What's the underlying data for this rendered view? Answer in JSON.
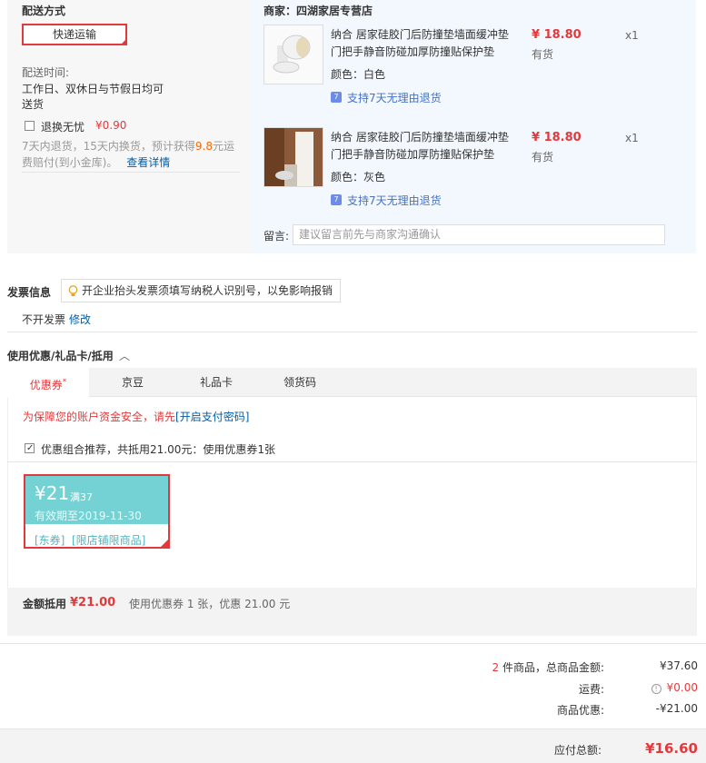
{
  "shipping": {
    "title": "配送方式",
    "method_button": "快递运输",
    "time_label": "配送时间:",
    "time_value_line1": "工作日、双休日与节假日均可",
    "time_value_line2": "送货",
    "insurance_label": "退换无忧",
    "insurance_price": "¥0.90",
    "insurance_desc_line1_a": "7天内退货，15天内换货，预计获得",
    "insurance_desc_highlight": "9.8",
    "insurance_desc_line1_b": "元运",
    "insurance_desc_line2": "费赔付(到小金库)。",
    "details_link": "查看详情"
  },
  "shop": {
    "name": "商家：四湖家居专营店",
    "products": [
      {
        "name": "纳合 居家硅胶门后防撞垫墙面缓冲垫门把手静音防碰加厚防撞贴保护垫",
        "color_label": "颜色：",
        "color": "白色",
        "price": "¥ 18.80",
        "stock": "有货",
        "qty": "x1",
        "return_policy": "支持7天无理由退货",
        "badge": "7"
      },
      {
        "name": "纳合 居家硅胶门后防撞垫墙面缓冲垫门把手静音防碰加厚防撞贴保护垫",
        "color_label": "颜色：",
        "color": "灰色",
        "price": "¥ 18.80",
        "stock": "有货",
        "qty": "x1",
        "return_policy": "支持7天无理由退货",
        "badge": "7"
      }
    ],
    "message_label": "留言:",
    "message_placeholder": "建议留言前先与商家沟通确认"
  },
  "invoice": {
    "title": "发票信息",
    "tip": "开企业抬头发票须填写纳税人识别号，以免影响报销",
    "status": "不开发票",
    "modify_link": "修改"
  },
  "discount": {
    "title": "使用优惠/礼品卡/抵用",
    "tabs": [
      "优惠券",
      "京豆",
      "礼品卡",
      "领货码"
    ],
    "active_tab": "优惠券",
    "security_text": "为保障您的账户资金安全，请先",
    "security_link": "[开启支付密码]",
    "combo_label": "优惠组合推荐，共抵用21.00元：使用优惠券1张",
    "coupon": {
      "amount": "¥21",
      "condition": "满37",
      "validity": "有效期至2019-11-30",
      "tags": "[东券]  [限店铺限商品]"
    },
    "summary_label": "金额抵用",
    "summary_amount": "¥21.00",
    "summary_desc": "使用优惠券 1 张，优惠 21.00 元"
  },
  "totals": {
    "count": "2",
    "count_suffix": " 件商品，总商品金额:",
    "goods_amount": "¥37.60",
    "freight_label": "运费:",
    "freight_amount": "¥0.00",
    "discount_label": "商品优惠:",
    "discount_amount": "-¥21.00",
    "payable_label": "应付总额:",
    "payable_amount": "¥16.60"
  },
  "colors": {
    "accent_red": "#e4393c",
    "link_blue": "#005ea7",
    "coupon_teal": "#74d2d4",
    "orange": "#ff6600"
  }
}
